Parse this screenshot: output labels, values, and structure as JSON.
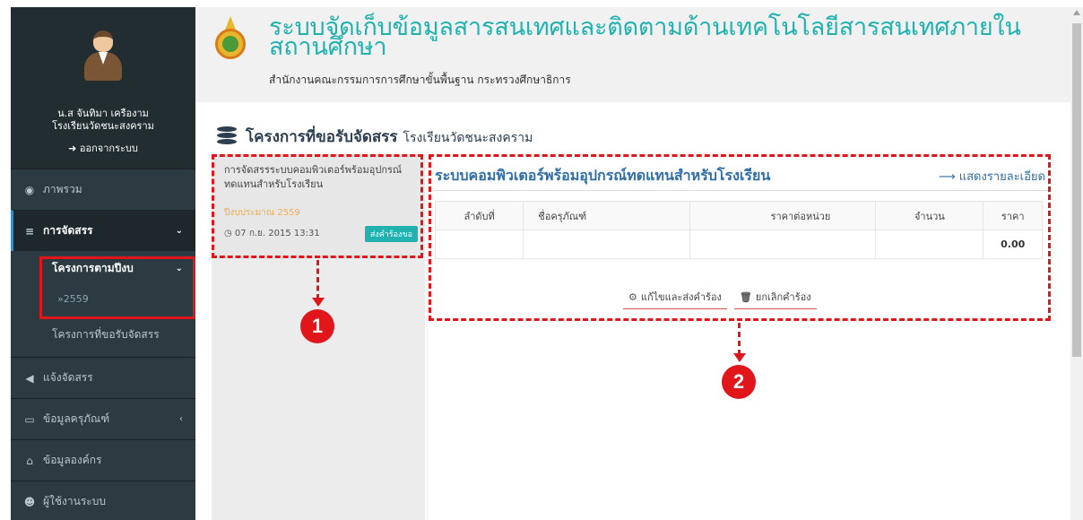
{
  "sidebar": {
    "user_name": "น.ส จันทิมา เครืองาม",
    "user_school": "โรงเรียนวัดชนะสงคราม",
    "logout_label": "ออกจากระบบ",
    "menu": {
      "overview": "ภาพรวม",
      "procurement": "การจัดสรร",
      "projects_by_year": "โครงการตามปีงบ",
      "year_2559": "»2559",
      "requested_projects": "โครงการที่ขอรับจัดสรร",
      "report": "แจ้งจัดสรร",
      "equipment": "ข้อมูลครุภัณฑ์",
      "organization": "ข้อมูลองค์กร",
      "users": "ผู้ใช้งานระบบ"
    }
  },
  "header": {
    "title": "ระบบจัดเก็บข้อมูลสารสนเทศและติดตามด้านเทคโนโลยีสารสนเทศภายในสถานศึกษา",
    "subtitle": "สำนักงานคณะกรรมการการศึกษาขั้นพื้นฐาน กระทรวงศึกษาธิการ"
  },
  "page": {
    "title": "โครงการที่ขอรับจัดสรร",
    "school": "โรงเรียนวัดชนะสงคราม"
  },
  "list": {
    "card": {
      "title": "การจัดสรรระบบคอมพิวเตอร์พร้อมอุปกรณ์ทดแทนสำหรับโรงเรียน",
      "budget_year": "ปีงบประมาณ 2559",
      "date": "07 ก.ย. 2015 13:31",
      "status": "ส่งคำร้องขอ"
    }
  },
  "detail": {
    "title": "ระบบคอมพิวเตอร์พร้อมอุปกรณ์ทดแทนสำหรับโรงเรียน",
    "link_label": "แสดงรายละเอียด",
    "columns": [
      "ลำดับที่",
      "ชื่อครุภัณฑ์",
      "ราคาต่อหน่วย",
      "จำนวน",
      "ราคา"
    ],
    "total": "0.00",
    "edit_button": "แก้ไขและส่งคำร้อง",
    "cancel_button": "ยกเลิกคำร้อง"
  },
  "markers": {
    "one": "1",
    "two": "2"
  },
  "colors": {
    "sidebar_bg": "#2c3b41",
    "accent_teal": "#21b2b0",
    "link_blue": "#2f6ea8",
    "annotation_red": "#e0161b"
  }
}
